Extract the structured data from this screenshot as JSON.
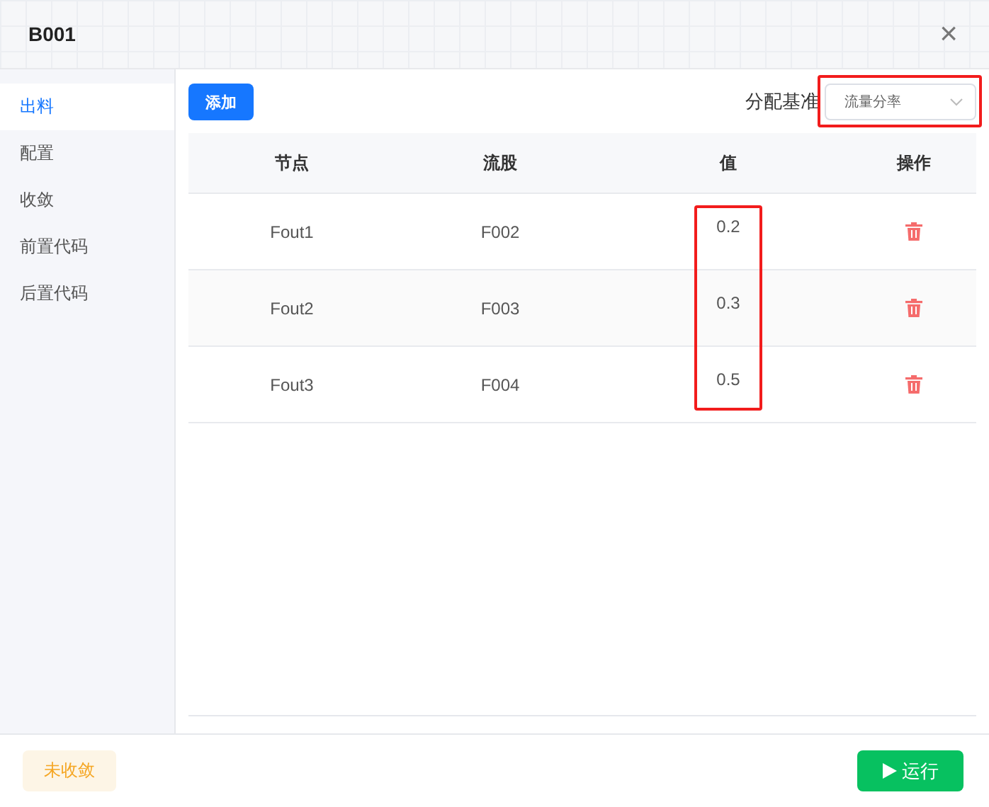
{
  "dialog": {
    "title": "B001",
    "close": "×"
  },
  "sidebar": {
    "items": [
      {
        "label": "出料",
        "selected": true
      },
      {
        "label": "配置",
        "selected": false
      },
      {
        "label": "收敛",
        "selected": false
      },
      {
        "label": "前置代码",
        "selected": false
      },
      {
        "label": "后置代码",
        "selected": false
      }
    ]
  },
  "toolbar": {
    "add_button": "添加",
    "basis_label": "分配基准",
    "basis_select": {
      "value": "流量分率",
      "highlighted": true
    }
  },
  "table": {
    "columns": [
      "节点",
      "流股",
      "值",
      "操作"
    ],
    "values_highlighted": true,
    "rows": [
      {
        "node": "Fout1",
        "stream": "F002",
        "value": "0.2"
      },
      {
        "node": "Fout2",
        "stream": "F003",
        "value": "0.3"
      },
      {
        "node": "Fout3",
        "stream": "F004",
        "value": "0.5"
      }
    ]
  },
  "footer": {
    "status": "未收敛",
    "run_button": "运行"
  }
}
